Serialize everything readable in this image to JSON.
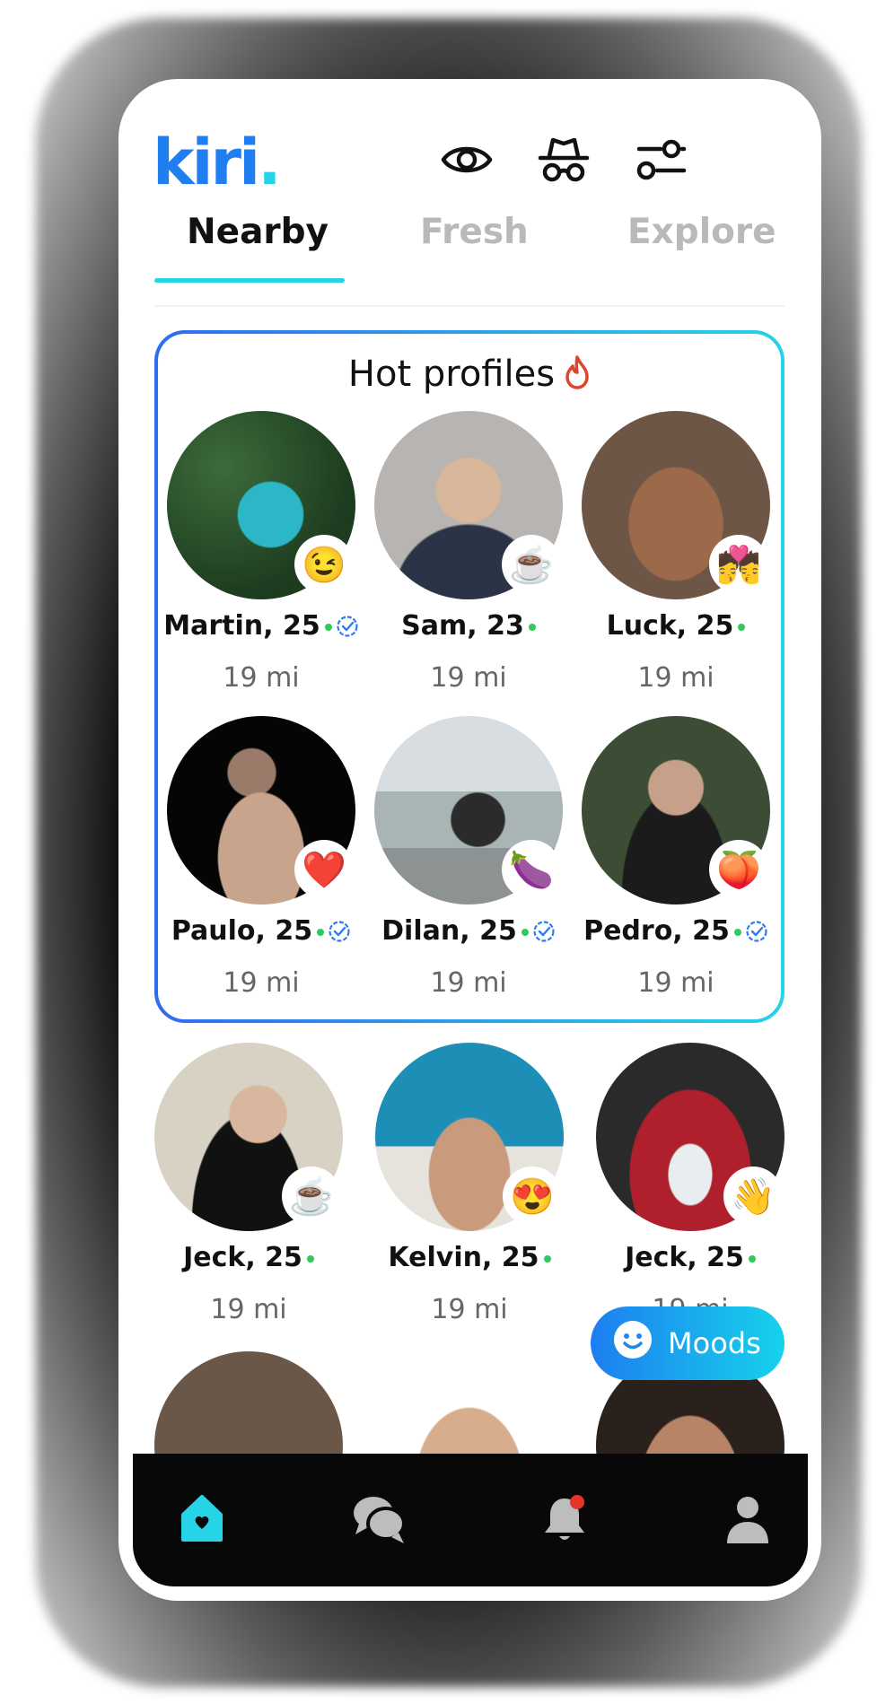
{
  "app": {
    "logo_text": "kiri",
    "logo_dot": "."
  },
  "header_icons": [
    "eye-icon",
    "incognito-icon",
    "filter-icon"
  ],
  "tabs": [
    {
      "label": "Nearby",
      "active": true
    },
    {
      "label": "Fresh",
      "active": false
    },
    {
      "label": "Explore",
      "active": false
    }
  ],
  "hot_profiles": {
    "title": "Hot profiles",
    "profiles": [
      {
        "name": "Martin, 25",
        "distance": "19 mi",
        "mood": "😉",
        "verified": true,
        "online": true
      },
      {
        "name": "Sam, 23",
        "distance": "19 mi",
        "mood": "☕",
        "verified": false,
        "online": true
      },
      {
        "name": "Luck, 25",
        "distance": "19 mi",
        "mood": "💏",
        "verified": false,
        "online": true
      },
      {
        "name": "Paulo, 25",
        "distance": "19 mi",
        "mood": "❤️",
        "verified": true,
        "online": true
      },
      {
        "name": "Dilan, 25",
        "distance": "19 mi",
        "mood": "🍆",
        "verified": true,
        "online": true
      },
      {
        "name": "Pedro, 25",
        "distance": "19 mi",
        "mood": "🍑",
        "verified": true,
        "online": true
      }
    ]
  },
  "nearby_profiles": [
    {
      "name": "Jeck, 25",
      "distance": "19 mi",
      "mood": "☕",
      "online": true
    },
    {
      "name": "Kelvin, 25",
      "distance": "19 mi",
      "mood": "😍",
      "online": true
    },
    {
      "name": "Jeck, 25",
      "distance": "19 mi",
      "mood": "👋",
      "online": true
    }
  ],
  "moods_button": {
    "label": "Moods"
  },
  "bottom_nav": [
    {
      "icon": "home-icon",
      "active": true,
      "badge": false
    },
    {
      "icon": "chat-icon",
      "active": false,
      "badge": false
    },
    {
      "icon": "bell-icon",
      "active": false,
      "badge": true
    },
    {
      "icon": "profile-icon",
      "active": false,
      "badge": false
    }
  ],
  "colors": {
    "brand_blue": "#1f7ef0",
    "accent_cyan": "#27d3e6",
    "online_green": "#2fc95c",
    "notification_red": "#e5352b",
    "nav_background": "#080808"
  }
}
